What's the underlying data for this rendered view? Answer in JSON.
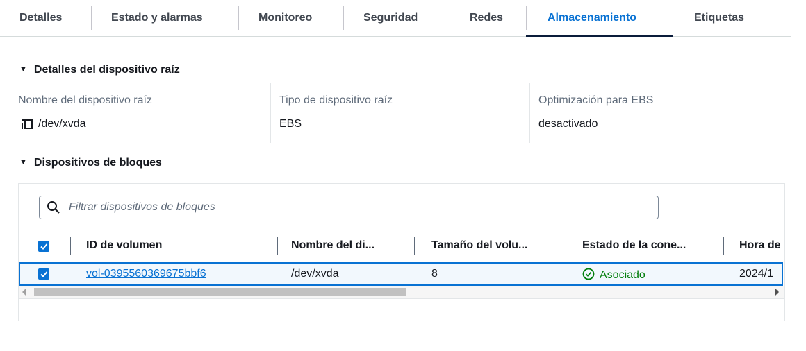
{
  "tabs": [
    {
      "label": "Detalles"
    },
    {
      "label": "Estado y alarmas"
    },
    {
      "label": "Monitoreo"
    },
    {
      "label": "Seguridad"
    },
    {
      "label": "Redes"
    },
    {
      "label": "Almacenamiento",
      "active": true
    },
    {
      "label": "Etiquetas"
    }
  ],
  "root_device": {
    "section_title": "Detalles del dispositivo raíz",
    "name_label": "Nombre del dispositivo raíz",
    "name_value": "/dev/xvda",
    "type_label": "Tipo de dispositivo raíz",
    "type_value": "EBS",
    "ebs_label": "Optimización para EBS",
    "ebs_value": "desactivado"
  },
  "block_devices": {
    "section_title": "Dispositivos de bloques",
    "search_placeholder": "Filtrar dispositivos de bloques",
    "columns": [
      "ID de volumen",
      "Nombre del di...",
      "Tamaño del volu...",
      "Estado de la cone...",
      "Hora de"
    ],
    "rows": [
      {
        "volume_id": "vol-0395560369675bbf6",
        "device_name": "/dev/xvda",
        "size": "8",
        "status": "Asociado",
        "time": "2024/1"
      }
    ]
  },
  "colors": {
    "accent": "#0972d3",
    "success": "#037f0c"
  }
}
